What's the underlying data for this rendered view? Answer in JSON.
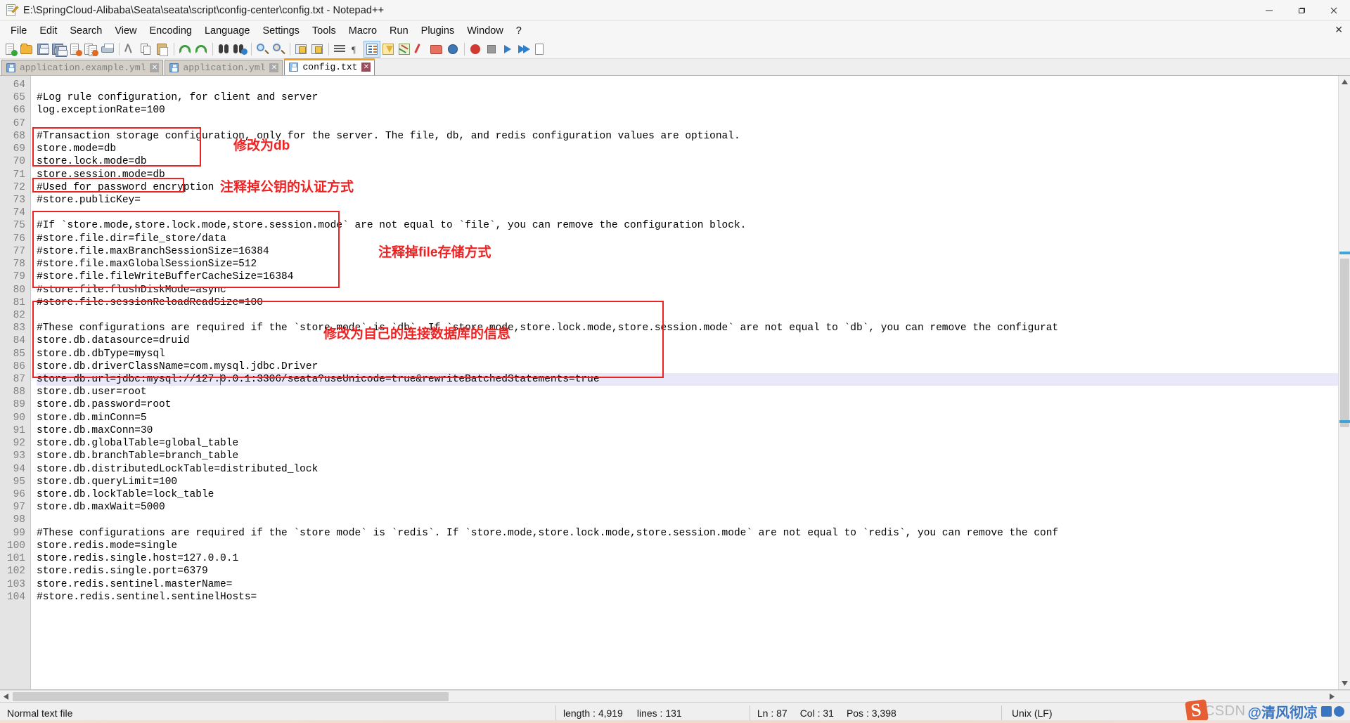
{
  "window": {
    "title": "E:\\SpringCloud-Alibaba\\Seata\\seata\\script\\config-center\\config.txt - Notepad++",
    "icon": "notepad-plus-plus-icon",
    "minimize_label": "–",
    "maximize_label": "❐",
    "close_label": "✕"
  },
  "menu": {
    "items": [
      "File",
      "Edit",
      "Search",
      "View",
      "Encoding",
      "Language",
      "Settings",
      "Tools",
      "Macro",
      "Run",
      "Plugins",
      "Window",
      "?"
    ],
    "close_doc_label": "✕"
  },
  "toolbar": {
    "buttons": [
      {
        "name": "new-file-icon",
        "title": "New"
      },
      {
        "name": "open-file-icon",
        "title": "Open"
      },
      {
        "name": "save-icon",
        "title": "Save"
      },
      {
        "name": "save-all-icon",
        "title": "Save All"
      },
      {
        "name": "close-file-icon",
        "title": "Close"
      },
      {
        "name": "close-all-icon",
        "title": "Close All"
      },
      {
        "name": "print-icon",
        "title": "Print"
      },
      {
        "name": "separator",
        "title": ""
      },
      {
        "name": "cut-icon",
        "title": "Cut"
      },
      {
        "name": "copy-icon",
        "title": "Copy"
      },
      {
        "name": "paste-icon",
        "title": "Paste"
      },
      {
        "name": "separator",
        "title": ""
      },
      {
        "name": "undo-icon",
        "title": "Undo"
      },
      {
        "name": "redo-icon",
        "title": "Redo"
      },
      {
        "name": "separator",
        "title": ""
      },
      {
        "name": "find-icon",
        "title": "Find"
      },
      {
        "name": "replace-icon",
        "title": "Replace"
      },
      {
        "name": "separator",
        "title": ""
      },
      {
        "name": "zoom-in-icon",
        "title": "Zoom In"
      },
      {
        "name": "zoom-out-icon",
        "title": "Zoom Out"
      },
      {
        "name": "separator",
        "title": ""
      },
      {
        "name": "sync-vertical-scroll-icon",
        "title": "Synchronize Vertical Scrolling"
      },
      {
        "name": "sync-horizontal-scroll-icon",
        "title": "Synchronize Horizontal Scrolling"
      },
      {
        "name": "word-wrap-icon",
        "title": "Word wrap"
      },
      {
        "name": "show-all-characters-icon",
        "title": "Show All Characters"
      },
      {
        "name": "separator",
        "title": ""
      },
      {
        "name": "show-indent-guide-icon",
        "title": "Show Indent Guide"
      },
      {
        "name": "user-defined-dialogue-icon",
        "title": "User-Defined Dialogue"
      },
      {
        "name": "document-map-icon",
        "title": "Document Map"
      },
      {
        "name": "function-list-icon",
        "title": "Function List"
      },
      {
        "name": "folder-as-workspace-icon",
        "title": "Folder as Workspace"
      },
      {
        "name": "monitoring-icon",
        "title": "Monitoring"
      },
      {
        "name": "separator",
        "title": ""
      },
      {
        "name": "macro-record-icon",
        "title": "Start Recording"
      },
      {
        "name": "macro-stop-icon",
        "title": "Stop Recording"
      },
      {
        "name": "macro-play-icon",
        "title": "Playback"
      }
    ]
  },
  "tabs": [
    {
      "label": "application.example.yml",
      "active": false,
      "close_label": "✕"
    },
    {
      "label": "application.yml",
      "active": false,
      "close_label": "✕"
    },
    {
      "label": "config.txt",
      "active": true,
      "close_label": "✕"
    }
  ],
  "editor": {
    "first_line_number": 64,
    "current_line": 87,
    "caret_column_index": 31,
    "lines": [
      {
        "n": 64,
        "text": ""
      },
      {
        "n": 65,
        "text": "#Log rule configuration, for client and server"
      },
      {
        "n": 66,
        "text": "log.exceptionRate=100"
      },
      {
        "n": 67,
        "text": ""
      },
      {
        "n": 68,
        "text": "#Transaction storage configuration, only for the server. The file, db, and redis configuration values are optional."
      },
      {
        "n": 69,
        "text": "store.mode=db"
      },
      {
        "n": 70,
        "text": "store.lock.mode=db"
      },
      {
        "n": 71,
        "text": "store.session.mode=db"
      },
      {
        "n": 72,
        "text": "#Used for password encryption"
      },
      {
        "n": 73,
        "text": "#store.publicKey="
      },
      {
        "n": 74,
        "text": ""
      },
      {
        "n": 75,
        "text": "#If `store.mode,store.lock.mode,store.session.mode` are not equal to `file`, you can remove the configuration block."
      },
      {
        "n": 76,
        "text": "#store.file.dir=file_store/data"
      },
      {
        "n": 77,
        "text": "#store.file.maxBranchSessionSize=16384"
      },
      {
        "n": 78,
        "text": "#store.file.maxGlobalSessionSize=512"
      },
      {
        "n": 79,
        "text": "#store.file.fileWriteBufferCacheSize=16384"
      },
      {
        "n": 80,
        "text": "#store.file.flushDiskMode=async"
      },
      {
        "n": 81,
        "text": "#store.file.sessionReloadReadSize=100"
      },
      {
        "n": 82,
        "text": ""
      },
      {
        "n": 83,
        "text": "#These configurations are required if the `store mode` is `db`. If `store.mode,store.lock.mode,store.session.mode` are not equal to `db`, you can remove the configurat"
      },
      {
        "n": 84,
        "text": "store.db.datasource=druid"
      },
      {
        "n": 85,
        "text": "store.db.dbType=mysql"
      },
      {
        "n": 86,
        "text": "store.db.driverClassName=com.mysql.jdbc.Driver"
      },
      {
        "n": 87,
        "text": "store.db.url=jdbc:mysql://127.0.0.1:3306/seata?useUnicode=true&rewriteBatchedStatements=true"
      },
      {
        "n": 88,
        "text": "store.db.user=root"
      },
      {
        "n": 89,
        "text": "store.db.password=root"
      },
      {
        "n": 90,
        "text": "store.db.minConn=5"
      },
      {
        "n": 91,
        "text": "store.db.maxConn=30"
      },
      {
        "n": 92,
        "text": "store.db.globalTable=global_table"
      },
      {
        "n": 93,
        "text": "store.db.branchTable=branch_table"
      },
      {
        "n": 94,
        "text": "store.db.distributedLockTable=distributed_lock"
      },
      {
        "n": 95,
        "text": "store.db.queryLimit=100"
      },
      {
        "n": 96,
        "text": "store.db.lockTable=lock_table"
      },
      {
        "n": 97,
        "text": "store.db.maxWait=5000"
      },
      {
        "n": 98,
        "text": ""
      },
      {
        "n": 99,
        "text": "#These configurations are required if the `store mode` is `redis`. If `store.mode,store.lock.mode,store.session.mode` are not equal to `redis`, you can remove the conf"
      },
      {
        "n": 100,
        "text": "store.redis.mode=single"
      },
      {
        "n": 101,
        "text": "store.redis.single.host=127.0.0.1"
      },
      {
        "n": 102,
        "text": "store.redis.single.port=6379"
      },
      {
        "n": 103,
        "text": "store.redis.sentinel.masterName="
      },
      {
        "n": 104,
        "text": "#store.redis.sentinel.sentinelHosts="
      }
    ]
  },
  "annotations": {
    "color": "#ee2222",
    "notes": [
      {
        "id": "note-db-mode",
        "text": "修改为db"
      },
      {
        "id": "note-public-key",
        "text": "注释掉公钥的认证方式"
      },
      {
        "id": "note-file-store",
        "text": "注释掉file存储方式"
      },
      {
        "id": "note-db-conn",
        "text": "修改为自己的连接数据库的信息"
      }
    ],
    "boxes": [
      {
        "id": "box-store-mode",
        "lines": "69-71"
      },
      {
        "id": "box-public-key",
        "lines": "73"
      },
      {
        "id": "box-file-store",
        "lines": "76-81"
      },
      {
        "id": "box-db-conn",
        "lines": "84-89"
      }
    ]
  },
  "statusbar": {
    "file_type": "Normal text file",
    "length_label": "length : 4,919",
    "lines_label": "lines : 131",
    "ln_label": "Ln : 87",
    "col_label": "Col : 31",
    "pos_label": "Pos : 3,398",
    "eol_label": "Unix (LF)"
  },
  "watermark": {
    "brand": "CSDN",
    "handle": "@清风彻凉"
  }
}
